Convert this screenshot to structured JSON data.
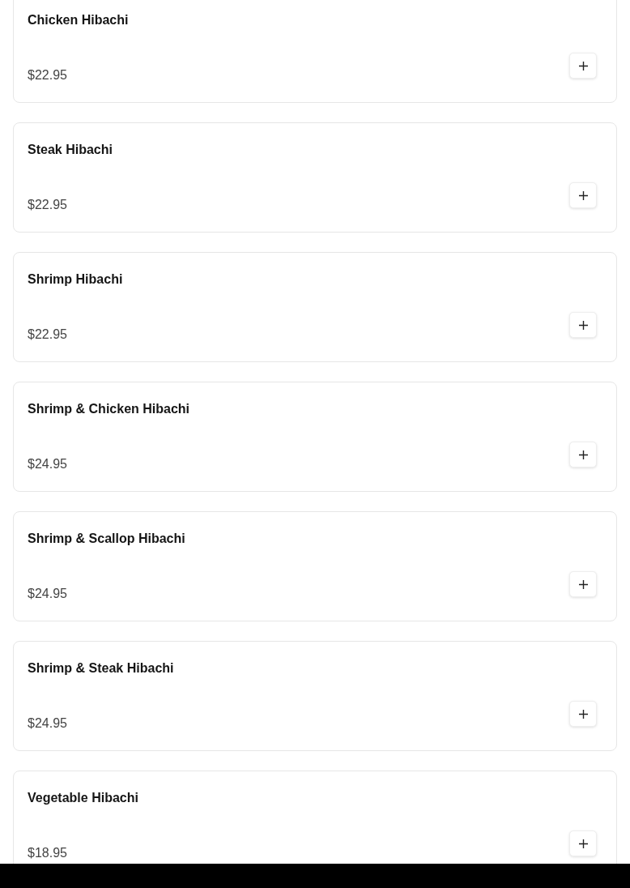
{
  "menu_items": [
    {
      "name": "Chicken Hibachi",
      "price": "$22.95"
    },
    {
      "name": "Steak Hibachi",
      "price": "$22.95"
    },
    {
      "name": "Shrimp Hibachi",
      "price": "$22.95"
    },
    {
      "name": "Shrimp & Chicken Hibachi",
      "price": "$24.95"
    },
    {
      "name": "Shrimp & Scallop Hibachi",
      "price": "$24.95"
    },
    {
      "name": "Shrimp & Steak Hibachi",
      "price": "$24.95"
    },
    {
      "name": "Vegetable Hibachi",
      "price": "$18.95"
    }
  ]
}
